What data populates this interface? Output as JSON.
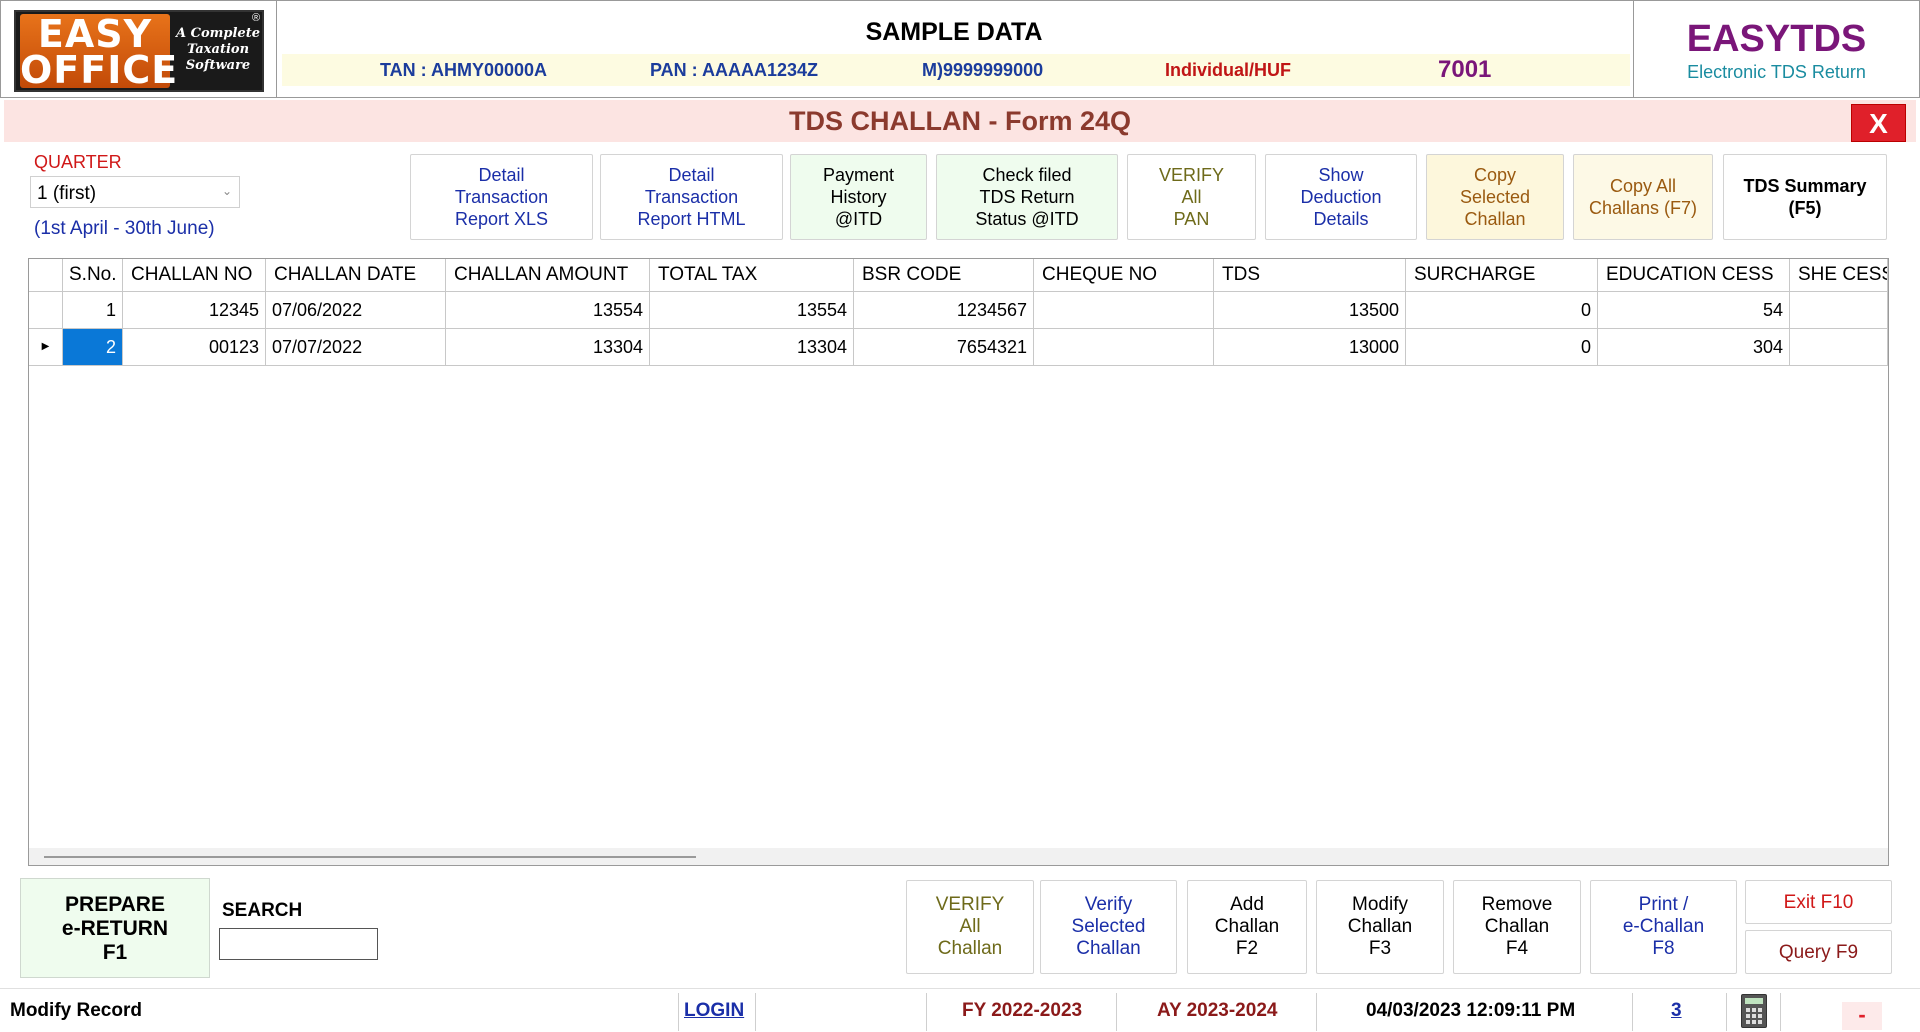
{
  "header": {
    "logo": {
      "word1": "EASY",
      "word2": "OFFICE",
      "tagline": "A Complete Taxation Software",
      "reg": "®"
    },
    "title": "SAMPLE DATA",
    "tan": "TAN : AHMY00000A",
    "pan": "PAN : AAAAA1234Z",
    "mobile": "M)9999999000",
    "category": "Individual/HUF",
    "code": "7001",
    "brand_title": "EASYTDS",
    "brand_subtitle": "Electronic TDS Return"
  },
  "page": {
    "title": "TDS CHALLAN - Form 24Q",
    "close_label": "X"
  },
  "quarter": {
    "label": "QUARTER",
    "selected": "1 (first)",
    "range": "(1st April - 30th June)"
  },
  "top_buttons": [
    {
      "label": "Detail\nTransaction\nReport XLS",
      "color": "#1b2fa8",
      "bg": "#ffffff"
    },
    {
      "label": "Detail\nTransaction\nReport HTML",
      "color": "#1b2fa8",
      "bg": "#ffffff"
    },
    {
      "label": "Payment\nHistory\n@ITD",
      "color": "#000000",
      "bg": "#effcee"
    },
    {
      "label": "Check filed\nTDS Return\nStatus @ITD",
      "color": "#000000",
      "bg": "#effcee"
    },
    {
      "label": "VERIFY\nAll\nPAN",
      "color": "#6e6a1a",
      "bg": "#ffffff"
    },
    {
      "label": "Show\nDeduction\nDetails",
      "color": "#1b2fa8",
      "bg": "#ffffff"
    },
    {
      "label": "Copy\nSelected\nChallan",
      "color": "#9a5a10",
      "bg": "#fdf7dc"
    },
    {
      "label": "Copy All\nChallans (F7)",
      "color": "#9a5a10",
      "bg": "#fdf9e6"
    },
    {
      "label": "TDS Summary\n(F5)",
      "color": "#000000",
      "bg": "#ffffff"
    }
  ],
  "grid": {
    "columns": [
      "S.No.",
      "CHALLAN NO",
      "CHALLAN DATE",
      "CHALLAN AMOUNT",
      "TOTAL TAX",
      "BSR CODE",
      "CHEQUE NO",
      "TDS",
      "SURCHARGE",
      "EDUCATION CESS",
      "SHE CESS"
    ],
    "rows": [
      {
        "sno": "1",
        "challan_no": "12345",
        "challan_date": "07/06/2022",
        "amount": "13554",
        "total_tax": "13554",
        "bsr": "1234567",
        "cheque": "",
        "tds": "13500",
        "surcharge": "0",
        "edu_cess": "54",
        "she_cess": ""
      },
      {
        "sno": "2",
        "challan_no": "00123",
        "challan_date": "07/07/2022",
        "amount": "13304",
        "total_tax": "13304",
        "bsr": "7654321",
        "cheque": "",
        "tds": "13000",
        "surcharge": "0",
        "edu_cess": "304",
        "she_cess": ""
      }
    ],
    "selected_row": 2
  },
  "bottom": {
    "prepare_label": "PREPARE\ne-RETURN\nF1",
    "search_label": "SEARCH",
    "search_value": "",
    "buttons": [
      {
        "label": "VERIFY\nAll\nChallan",
        "color": "#6e6a1a"
      },
      {
        "label": "Verify\nSelected\nChallan",
        "color": "#1b2fa8"
      },
      {
        "label": "Add\nChallan\nF2",
        "color": "#000000"
      },
      {
        "label": "Modify\nChallan\nF3",
        "color": "#000000"
      },
      {
        "label": "Remove\nChallan\nF4",
        "color": "#000000"
      },
      {
        "label": "Print /\ne-Challan\nF8",
        "color": "#1b2fa8"
      }
    ],
    "exit_label": "Exit F10",
    "query_label": "Query F9"
  },
  "status": {
    "mode": "Modify Record",
    "login": "LOGIN",
    "fy": "FY 2022-2023",
    "ay": "AY 2023-2024",
    "datetime": "04/03/2023 12:09:11 PM",
    "count": "3",
    "dash": "-"
  }
}
